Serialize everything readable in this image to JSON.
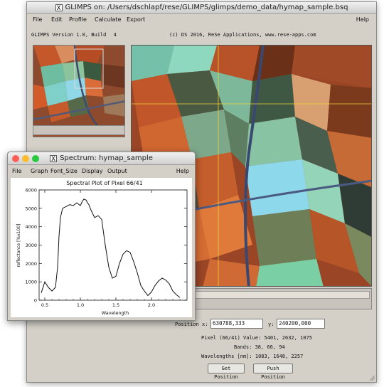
{
  "main_window": {
    "title": "GLIMPS on: /Users/dschlapf/rese/GLIMPS/glimps/demo_data/hymap_sample.bsq",
    "menu": [
      "File",
      "Edit",
      "Profile",
      "Calculate",
      "Export"
    ],
    "help": "Help",
    "version_label": "GLIMPS Version 1.0, Build",
    "build_number": "4",
    "copyright": "(c) DS 2016, ReSe Applications, www.rese-apps.com",
    "position_label": "Position",
    "x_label": "x:",
    "x_value": "630788,333",
    "y_label": "y:",
    "y_value": "240200,000",
    "pixel_info": "Pixel (66/41) Value:  5401,  2632,  1075",
    "bands_info": "Bands:   38,   66,   94",
    "wavelengths_info": "Wavelengths [nm]:  1083,  1648,  2257",
    "get_position": "Get Position",
    "push_position": "Push Position"
  },
  "spectrum_window": {
    "title": "Spectrum: hymap_sample",
    "menu": [
      "File",
      "Graph",
      "Font_Size",
      "Display",
      "Output"
    ],
    "help": "Help",
    "traffic_colors": [
      "#fd5f57",
      "#fdbc2e",
      "#29c940"
    ]
  },
  "chart_data": {
    "type": "line",
    "title": "Spectral Plot of Pixel 66/41",
    "xlabel": "Wavelength",
    "ylabel": "reflectance [%x100]",
    "xlim": [
      0.42,
      2.5
    ],
    "ylim": [
      0,
      6000
    ],
    "x_ticks": [
      "0.5",
      "1.0",
      "1.5",
      "2.0"
    ],
    "y_ticks": [
      "0",
      "1000",
      "2000",
      "3000",
      "4000",
      "5000",
      "6000"
    ],
    "x": [
      0.45,
      0.5,
      0.55,
      0.6,
      0.65,
      0.68,
      0.7,
      0.72,
      0.75,
      0.8,
      0.85,
      0.9,
      0.95,
      1.0,
      1.03,
      1.05,
      1.08,
      1.1,
      1.12,
      1.15,
      1.2,
      1.25,
      1.3,
      1.35,
      1.4,
      1.45,
      1.5,
      1.55,
      1.6,
      1.65,
      1.7,
      1.75,
      1.8,
      1.85,
      1.9,
      1.95,
      2.0,
      2.05,
      2.1,
      2.15,
      2.2,
      2.25,
      2.3,
      2.35,
      2.4
    ],
    "y": [
      400,
      1000,
      700,
      500,
      700,
      1800,
      3500,
      4500,
      5000,
      5100,
      5200,
      5150,
      5300,
      5150,
      5400,
      5500,
      5450,
      5300,
      5200,
      4900,
      4500,
      4600,
      4400,
      3000,
      1800,
      1200,
      1300,
      2000,
      2500,
      2700,
      2600,
      2100,
      1500,
      800,
      500,
      250,
      450,
      800,
      1050,
      1200,
      1100,
      900,
      500,
      300,
      150
    ]
  }
}
